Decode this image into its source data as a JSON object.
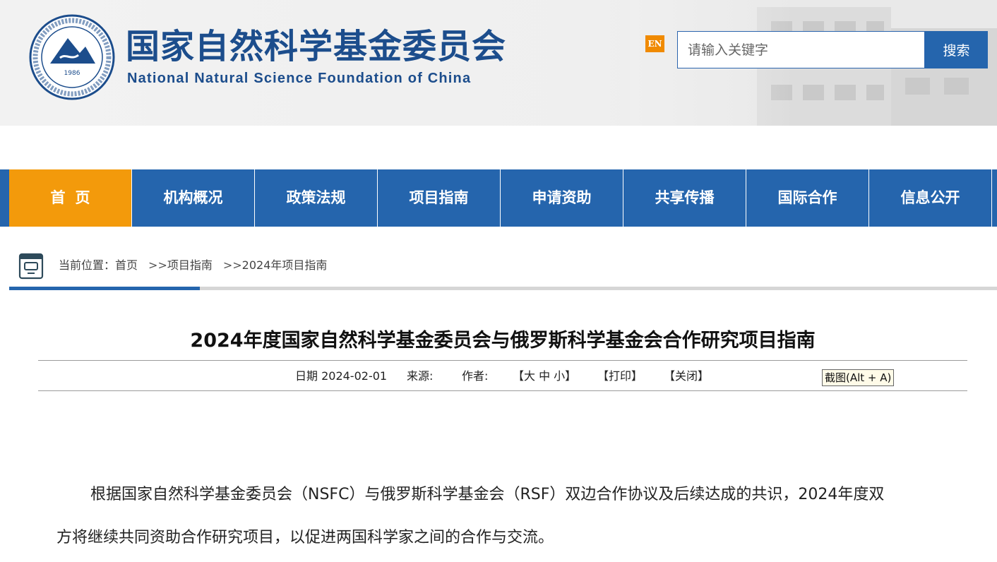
{
  "header": {
    "org_name_cn": "国家自然科学基金委员会",
    "org_name_en": "National Natural Science Foundation of China",
    "logo_year": "1986",
    "language_switch": "EN",
    "search": {
      "placeholder": "请输入关键字",
      "button_label": "搜索"
    }
  },
  "nav": {
    "items": [
      {
        "label": "首页",
        "active": true
      },
      {
        "label": "机构概况"
      },
      {
        "label": "政策法规"
      },
      {
        "label": "项目指南"
      },
      {
        "label": "申请资助"
      },
      {
        "label": "共享传播"
      },
      {
        "label": "国际合作"
      },
      {
        "label": "信息公开"
      }
    ]
  },
  "breadcrumb": {
    "prefix": "当前位置：",
    "items": [
      "首页",
      "项目指南",
      "2024年项目指南"
    ],
    "separator": ">>"
  },
  "article": {
    "title": "2024年度国家自然科学基金委员会与俄罗斯科学基金会合作研究项目指南",
    "meta": {
      "date": "日期 2024-02-01",
      "source": "来源:",
      "author": "作者:",
      "font_size_links": "【大 中 小】",
      "print": "【打印】",
      "close": "【关闭】",
      "capture": "截图(Alt + A)"
    },
    "paragraph_lines": [
      "根据国家自然科学基金委员会（NSFC）与俄罗斯科学基金会（RSF）双边合作协议及后续达成的共识，2024年度双",
      "方将继续共同资助合作研究项目，以促进两国科学家之间的合作与交流。"
    ]
  },
  "colors": {
    "brand_blue": "#2565ad",
    "nav_active": "#f39a0b",
    "en_badge": "#f08a00",
    "logo_text": "#1c4d8c"
  }
}
